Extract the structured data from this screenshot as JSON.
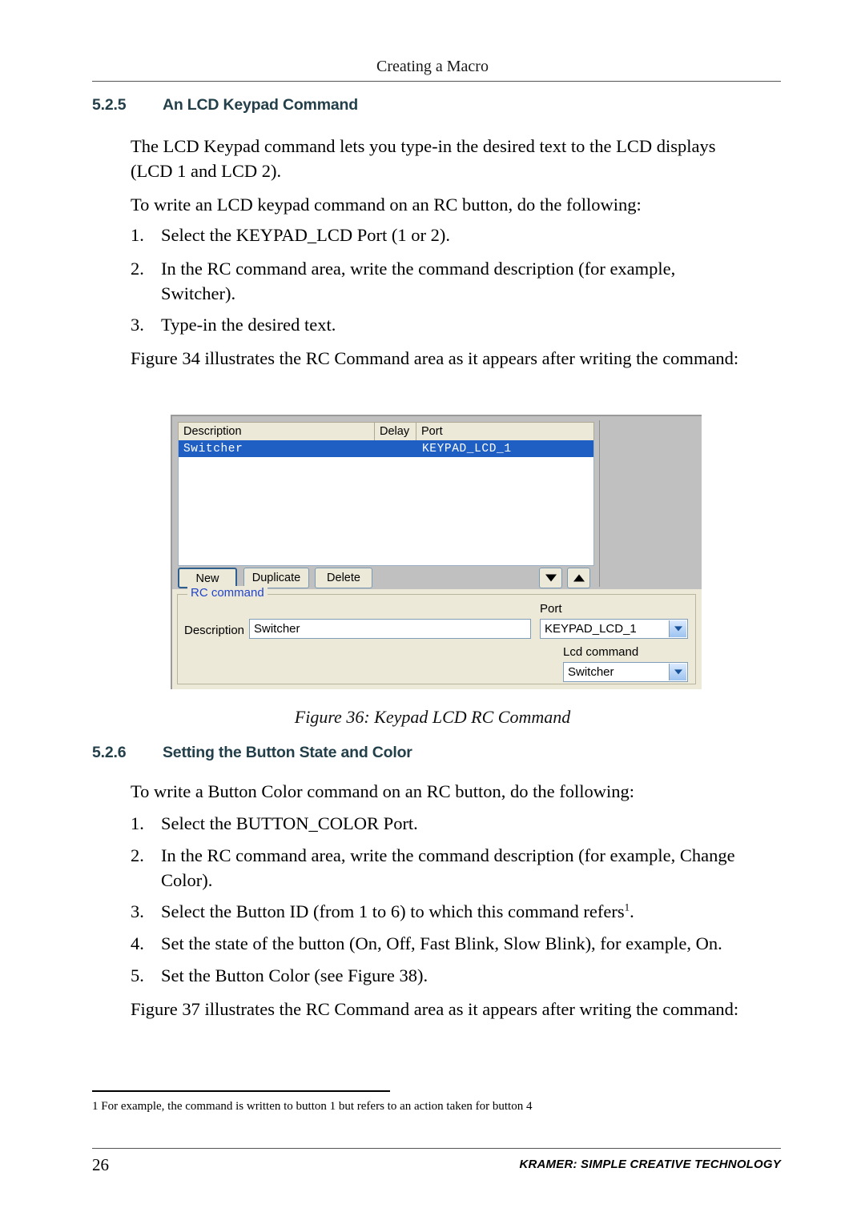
{
  "page": {
    "running_head": "Creating a Macro",
    "page_number": "26",
    "footer_brand": "KRAMER:  SIMPLE CREATIVE TECHNOLOGY"
  },
  "section_525": {
    "number": "5.2.5",
    "title": "An LCD Keypad Command",
    "intro": "The LCD Keypad command lets you type-in the desired text to the LCD displays (LCD 1 and LCD 2).",
    "lead_in": "To write an LCD keypad command on an RC button, do the following:",
    "steps": [
      {
        "marker": "1.",
        "text": "Select the KEYPAD_LCD Port (1 or 2)."
      },
      {
        "marker": "2.",
        "text": "In the RC command area, write the command description (for example, Switcher)."
      },
      {
        "marker": "3.",
        "text": "Type-in the desired text."
      }
    ],
    "figure_ref": "Figure 34 illustrates the RC Command area as it appears after writing the command:"
  },
  "figure36": {
    "caption": "Figure 36: Keypad LCD RC Command",
    "list": {
      "columns": [
        "Description",
        "Delay",
        "Port"
      ],
      "rows": [
        {
          "description": "Switcher",
          "delay": "",
          "port": "KEYPAD_LCD_1",
          "selected": true
        }
      ]
    },
    "buttons": {
      "new": "New",
      "duplicate": "Duplicate",
      "delete": "Delete",
      "move_down_icon": "triangle-down-icon",
      "move_up_icon": "triangle-up-icon"
    },
    "rc_command": {
      "legend": "RC command",
      "description_label": "Description",
      "description_value": "Switcher",
      "port_label": "Port",
      "port_value": "KEYPAD_LCD_1",
      "lcd_command_label": "Lcd command",
      "lcd_command_value": "Switcher"
    },
    "colors": {
      "selection_blue": "#1f5fc4",
      "dialog_face": "#ece9d8",
      "grey_pane": "#c0c0c0",
      "legend_blue": "#2244cc"
    }
  },
  "section_526": {
    "number": "5.2.6",
    "title": "Setting the Button State and Color",
    "lead_in": "To write a Button Color command on an RC button, do the following:",
    "steps": [
      {
        "marker": "1.",
        "text": "Select the BUTTON_COLOR Port."
      },
      {
        "marker": "2.",
        "text": "In the RC command area, write the command description (for example, Change Color)."
      },
      {
        "marker": "3.",
        "text": "Select the Button ID (from 1 to 6) to which this command refers",
        "superscript": "1",
        "tail": "."
      },
      {
        "marker": "4.",
        "text": "Set the state of the button (On, Off, Fast Blink, Slow Blink), for example, On."
      },
      {
        "marker": "5.",
        "text": "Set the Button Color (see Figure 38)."
      }
    ],
    "figure_ref": "Figure 37 illustrates the RC Command area as it appears after writing the command:"
  },
  "footnote": {
    "text": "1 For example, the command is written to button 1 but refers to an action taken for button 4"
  }
}
